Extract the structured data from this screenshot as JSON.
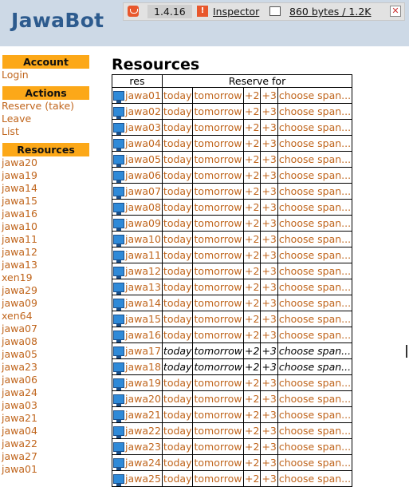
{
  "app": {
    "title": "JawaBot"
  },
  "devbar": {
    "version": "1.4.16",
    "inspector": "Inspector",
    "bytes": "860 bytes / 1.2K",
    "close": "✕"
  },
  "sidebar": {
    "account_header": "Account",
    "login": "Login",
    "actions_header": "Actions",
    "actions": [
      "Reserve (take)",
      "Leave",
      "List"
    ],
    "resources_header": "Resources",
    "resources": [
      "jawa20",
      "jawa19",
      "jawa14",
      "jawa15",
      "jawa16",
      "jawa10",
      "jawa11",
      "jawa12",
      "jawa13",
      "xen19",
      "jawa29",
      "jawa09",
      "xen64",
      "jawa07",
      "jawa08",
      "jawa05",
      "jawa23",
      "jawa06",
      "jawa24",
      "jawa03",
      "jawa21",
      "jawa04",
      "jawa22",
      "jawa27",
      "jawa01"
    ]
  },
  "main": {
    "title": "Resources",
    "col_res": "res",
    "col_reserve": "Reserve for",
    "actions": [
      "today",
      "tomorrow",
      "+2",
      "+3",
      "choose span..."
    ],
    "rows": [
      {
        "name": "jawa01",
        "reserved": false
      },
      {
        "name": "jawa02",
        "reserved": false
      },
      {
        "name": "jawa03",
        "reserved": false
      },
      {
        "name": "jawa04",
        "reserved": false
      },
      {
        "name": "jawa05",
        "reserved": false
      },
      {
        "name": "jawa06",
        "reserved": false
      },
      {
        "name": "jawa07",
        "reserved": false
      },
      {
        "name": "jawa08",
        "reserved": false
      },
      {
        "name": "jawa09",
        "reserved": false
      },
      {
        "name": "jawa10",
        "reserved": false
      },
      {
        "name": "jawa11",
        "reserved": false
      },
      {
        "name": "jawa12",
        "reserved": false
      },
      {
        "name": "jawa13",
        "reserved": false
      },
      {
        "name": "jawa14",
        "reserved": false
      },
      {
        "name": "jawa15",
        "reserved": false
      },
      {
        "name": "jawa16",
        "reserved": false
      },
      {
        "name": "jawa17",
        "reserved": true
      },
      {
        "name": "jawa18",
        "reserved": true
      },
      {
        "name": "jawa19",
        "reserved": false
      },
      {
        "name": "jawa20",
        "reserved": false
      },
      {
        "name": "jawa21",
        "reserved": false
      },
      {
        "name": "jawa22",
        "reserved": false
      },
      {
        "name": "jawa23",
        "reserved": false
      },
      {
        "name": "jawa24",
        "reserved": false
      },
      {
        "name": "jawa25",
        "reserved": false
      }
    ]
  },
  "colors": {
    "header_bg": "#cdd9e6",
    "logo": "#2d5b8e",
    "sidebar_header": "#fca818",
    "link": "#c0651c",
    "icon": "#2f8ad8"
  },
  "icons": {
    "resource": "monitor-icon",
    "devbar_logo": "devbar-logo-icon",
    "inspector": "inspector-icon",
    "screen": "screen-icon",
    "close": "close-icon"
  }
}
